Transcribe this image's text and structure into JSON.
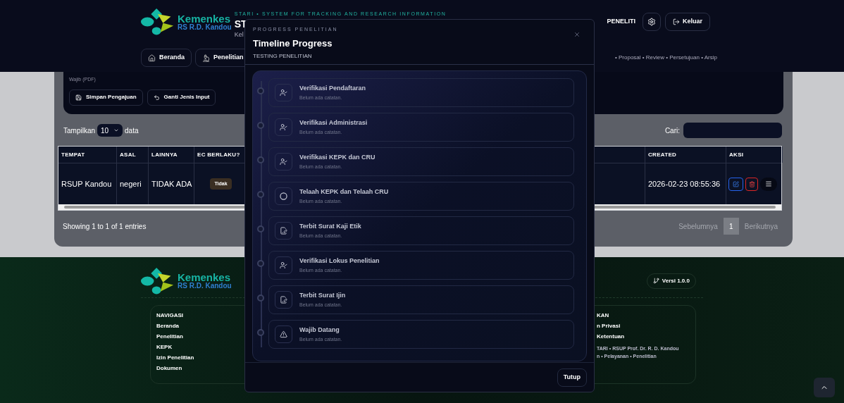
{
  "header": {
    "logo": {
      "title": "Kemenkes",
      "subtitle": "RS R.D. Kandou"
    },
    "tagline": "STARI • SYSTEM FOR TRACKING AND RESEARCH INFORMATION",
    "app_title": "ST",
    "app_subtitle": "Kel",
    "role": "PENELITI",
    "logout": "Keluar",
    "nav": [
      "Beranda",
      "Penelitian"
    ],
    "breadcrumb": "• Proposal • Review • Persetujuan • Arsip"
  },
  "form": {
    "note": "Wajib (PDF)",
    "buttons": [
      "Simpan Pengajuan",
      "Ganti Jenis Input"
    ]
  },
  "table": {
    "length_label": "Tampilkan",
    "length_value": "10",
    "length_suffix": "data",
    "search_label": "Cari:",
    "columns": [
      "TEMPAT",
      "ASAL",
      "LAINNYA",
      "EC BERLAKU?",
      "CREATED",
      "AKSI"
    ],
    "rows": [
      {
        "cells": [
          "RSUP Kandou",
          "negeri",
          "TIDAK ADA",
          "Tidak",
          "2026-02-23 08:55:36"
        ]
      }
    ],
    "info": "Showing 1 to 1 of 1 entries",
    "pagination": {
      "previous": "Sebelumnya",
      "pages": [
        {
          "label": "1",
          "selected": true
        }
      ],
      "next": "Berikutnya"
    }
  },
  "footer": {
    "logo": {
      "title": "Kemenkes",
      "subtitle": "RS R.D. Kandou"
    },
    "version": "Versi 1.0.0",
    "nav_heading": "NAVIGASI",
    "nav_links": [
      "Beranda",
      "Penelitian",
      "KEPK",
      "Izin Penelitian",
      "Dokumen"
    ],
    "right_heading": "KAN",
    "right_links": [
      "n Privasi",
      "Ketentuan"
    ],
    "copyright": [
      "TARI • RSUP Prof. Dr. R. D. Kandou",
      "n • Pelayanan • Penelitian"
    ]
  },
  "modal": {
    "eyebrow": "PROGRESS PENELITIAN",
    "title": "Timeline Progress",
    "subtitle": "TESTING PENELITIAN",
    "close": "Tutup",
    "steps": [
      {
        "title": "Verifikasi Pendaftaran",
        "note": "Belum ada catatan.",
        "kind": "verify"
      },
      {
        "title": "Verifikasi Administrasi",
        "note": "Belum ada catatan.",
        "kind": "verify"
      },
      {
        "title": "Verifikasi KEPK dan CRU",
        "note": "Belum ada catatan.",
        "kind": "verify"
      },
      {
        "title": "Telaah KEPK dan Telaah CRU",
        "note": "Belum ada catatan.",
        "kind": "review"
      },
      {
        "title": "Terbit Surat Kaji Etik",
        "note": "Belum ada catatan.",
        "kind": "letter"
      },
      {
        "title": "Verifikasi Lokus Penelitian",
        "note": "Belum ada catatan.",
        "kind": "verify"
      },
      {
        "title": "Terbit Surat Ijin",
        "note": "Belum ada catatan.",
        "kind": "letter"
      },
      {
        "title": "Wajib Datang",
        "note": "Belum ada catatan.",
        "kind": "warning"
      }
    ]
  }
}
